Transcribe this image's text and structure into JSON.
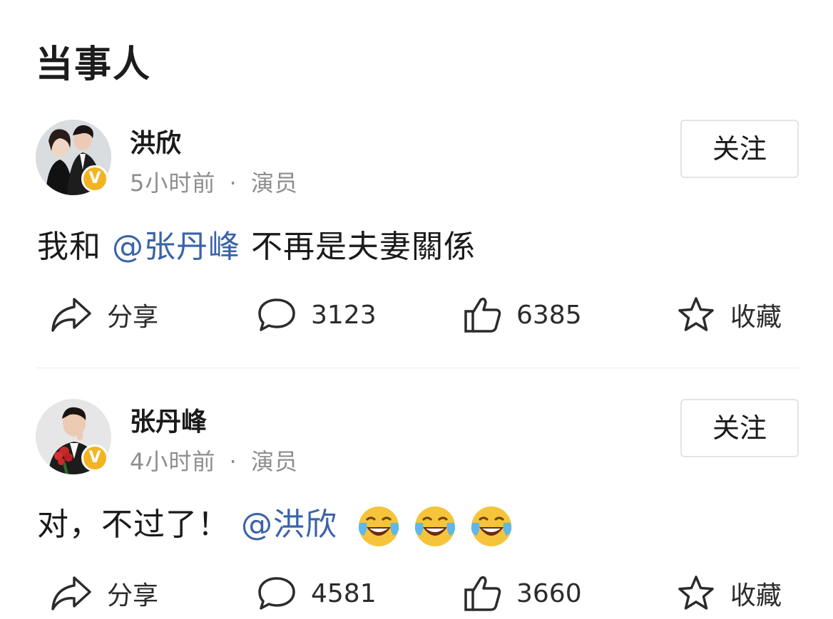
{
  "section_title": "当事人",
  "posts": [
    {
      "author": "洪欣",
      "time": "5小时前",
      "separator": "·",
      "role": "演员",
      "follow_label": "关注",
      "content_prefix": "我和 ",
      "mention": "@张丹峰",
      "content_suffix": " 不再是夫妻關係",
      "emoji_count": 0,
      "actions": {
        "share": "分享",
        "comments": "3123",
        "likes": "6385",
        "favorite": "收藏"
      }
    },
    {
      "author": "张丹峰",
      "time": "4小时前",
      "separator": "·",
      "role": "演员",
      "follow_label": "关注",
      "content_prefix": "对，不过了！",
      "mention": "@洪欣",
      "content_suffix": "",
      "emoji_count": 3,
      "actions": {
        "share": "分享",
        "comments": "4581",
        "likes": "3660",
        "favorite": "收藏"
      }
    }
  ],
  "verified_badge": "V",
  "colors": {
    "mention": "#3a63a8",
    "meta": "#8e8e8e",
    "badge": "#f2b422"
  }
}
